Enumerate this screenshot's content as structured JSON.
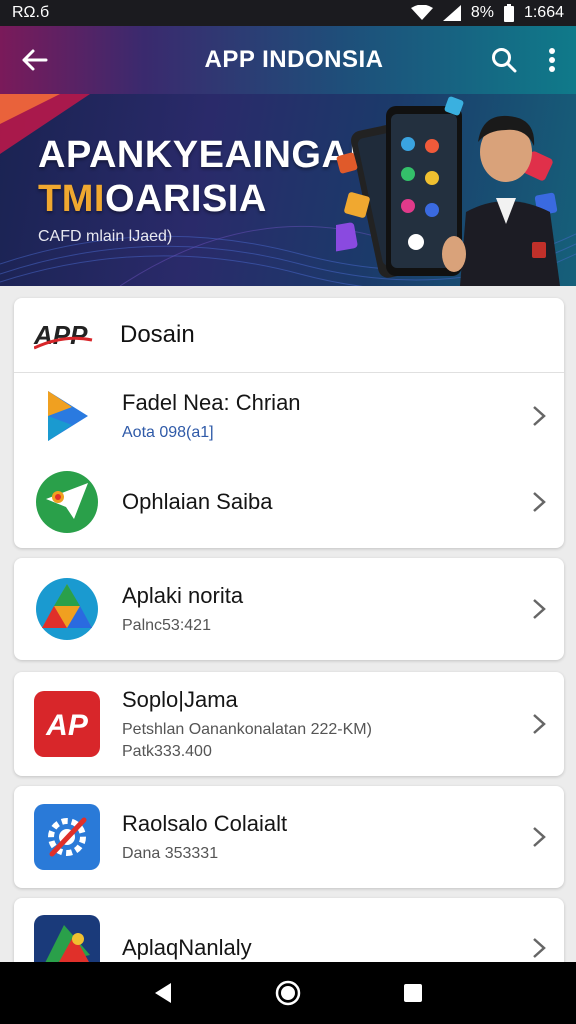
{
  "status": {
    "left": "RΩ.б",
    "battery": "8%",
    "time": "1:664"
  },
  "appbar": {
    "title": "APP INDONSIA"
  },
  "banner": {
    "line1": "APANKYEAINGAN",
    "line2_accent": "TMI",
    "line2_rest": "OARISIA",
    "tagline": "CAFD mlain lJaed)"
  },
  "section": {
    "logo": "APP",
    "title": "Dosain"
  },
  "items": [
    {
      "name": "Fadel Nea: Chrian",
      "sub": "Aota 098(a1]",
      "icon": "play-triangle-icon"
    },
    {
      "name": "Ophlaian Saiba",
      "sub": "",
      "icon": "green-paper-plane-icon"
    },
    {
      "name": "Aplaki norita",
      "sub": "Palnc53:421",
      "icon": "drive-triangle-icon"
    },
    {
      "name": "Soplo|Jama",
      "sub": "Petshlan Oanankonalatan 222-KM)",
      "sub2": "Patk333.400",
      "icon": "red-ap-icon"
    },
    {
      "name": "Raolsalo Colaialt",
      "sub": "Dana 353331",
      "icon": "blue-gear-icon"
    },
    {
      "name": "AplaqNanlaly",
      "sub": "",
      "icon": "map-app-icon"
    }
  ],
  "colors": {
    "appbar_start": "#7a1a5a",
    "appbar_end": "#0f7a8a",
    "accent": "#f0a830",
    "sub_blue": "#2f5aa8"
  }
}
